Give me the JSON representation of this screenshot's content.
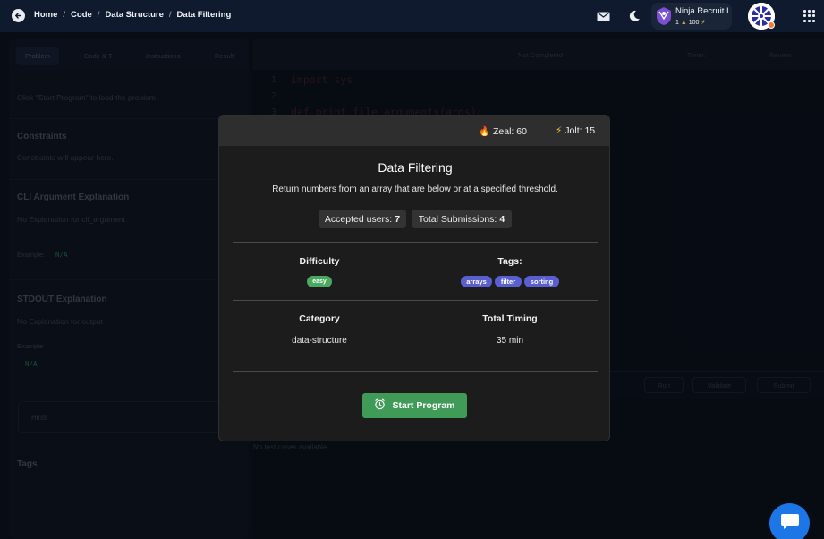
{
  "topbar": {
    "breadcrumb": [
      "Home",
      "Code",
      "Data Structure",
      "Data Filtering"
    ],
    "user": {
      "name": "Ninja Recruit I",
      "level": "1",
      "points": "100"
    },
    "colors": {
      "background": "#0f1a2e",
      "avatar_dot": "#f07a3a"
    },
    "icons": [
      "back-arrow-icon",
      "mail-icon",
      "moon-icon",
      "ninja-badge-icon",
      "avatar-icon",
      "apps-grid-icon"
    ]
  },
  "background_panel": {
    "tabs": [
      "Problem",
      "Code & T",
      "Instructions",
      "Result"
    ],
    "load_hint": "Click \"Start Program\" to load the problem.",
    "constraints_heading": "Constraints",
    "constraints_text": "Constraints will appear here.",
    "cli_heading": "CLI Argument Explanation",
    "cli_text": "No Explanation for cli_argument",
    "example_label": "Example:",
    "example_value": "N/A",
    "stdout_heading": "STDOUT Explanation",
    "stdout_text": "No Explanation for output",
    "example2_label": "Example",
    "example2_value": "N/A",
    "hints_label": "Hints",
    "tags_heading": "Tags"
  },
  "editor": {
    "status": "Not Completed",
    "timer_label": "Timer:",
    "review_label": "Review",
    "code_lines": [
      "import sys",
      "",
      "def print_file_arguments(args):"
    ],
    "run_label": "Run",
    "validate_label": "Validate",
    "submit_label": "Submit",
    "no_tests": "No test cases available."
  },
  "modal": {
    "zeal": "Zeal: 60",
    "jolt": "Jolt: 15",
    "title": "Data Filtering",
    "description": "Return numbers from an array that are below or at a specified threshold.",
    "accepted_label": "Accepted users:",
    "accepted_value": "7",
    "submissions_label": "Total Submissions:",
    "submissions_value": "4",
    "difficulty_heading": "Difficulty",
    "difficulty_value": "easy",
    "tags_heading": "Tags:",
    "tags": [
      "arrays",
      "filter",
      "sorting"
    ],
    "category_heading": "Category",
    "category_value": "data-structure",
    "timing_heading": "Total Timing",
    "timing_value": "35 min",
    "start_label": "Start Program",
    "colors": {
      "start_button": "#3f9b57",
      "easy_badge": "#48a95f",
      "tag": "#5a5fd0",
      "header": "#2e2e2e"
    }
  },
  "chat": {
    "icon": "chat-bubble-icon",
    "color": "#1d76e6"
  }
}
